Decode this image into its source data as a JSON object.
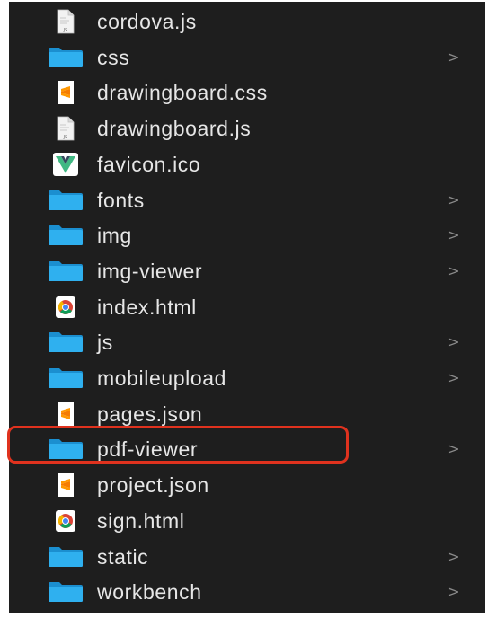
{
  "files": [
    {
      "name": "cordova.js",
      "icon": "js-file-icon",
      "folder": false
    },
    {
      "name": "css",
      "icon": "folder-icon",
      "folder": true
    },
    {
      "name": "drawingboard.css",
      "icon": "sublime-file-icon",
      "folder": false
    },
    {
      "name": "drawingboard.js",
      "icon": "js-file-icon",
      "folder": false
    },
    {
      "name": "favicon.ico",
      "icon": "vue-file-icon",
      "folder": false
    },
    {
      "name": "fonts",
      "icon": "folder-icon",
      "folder": true
    },
    {
      "name": "img",
      "icon": "folder-icon",
      "folder": true
    },
    {
      "name": "img-viewer",
      "icon": "folder-icon",
      "folder": true
    },
    {
      "name": "index.html",
      "icon": "chrome-file-icon",
      "folder": false
    },
    {
      "name": "js",
      "icon": "folder-icon",
      "folder": true
    },
    {
      "name": "mobileupload",
      "icon": "folder-icon",
      "folder": true
    },
    {
      "name": "pages.json",
      "icon": "sublime-file-icon",
      "folder": false
    },
    {
      "name": "pdf-viewer",
      "icon": "folder-icon",
      "folder": true,
      "highlighted": true
    },
    {
      "name": "project.json",
      "icon": "sublime-file-icon",
      "folder": false
    },
    {
      "name": "sign.html",
      "icon": "chrome-file-icon",
      "folder": false
    },
    {
      "name": "static",
      "icon": "folder-icon",
      "folder": true
    },
    {
      "name": "workbench",
      "icon": "folder-icon",
      "folder": true
    }
  ],
  "chevron_glyph": ">",
  "colors": {
    "background": "#1e1e1e",
    "text": "#e6e6e6",
    "folder": "#2aa7e8",
    "highlight_border": "#e0321e",
    "sublime": "#ff9800"
  }
}
